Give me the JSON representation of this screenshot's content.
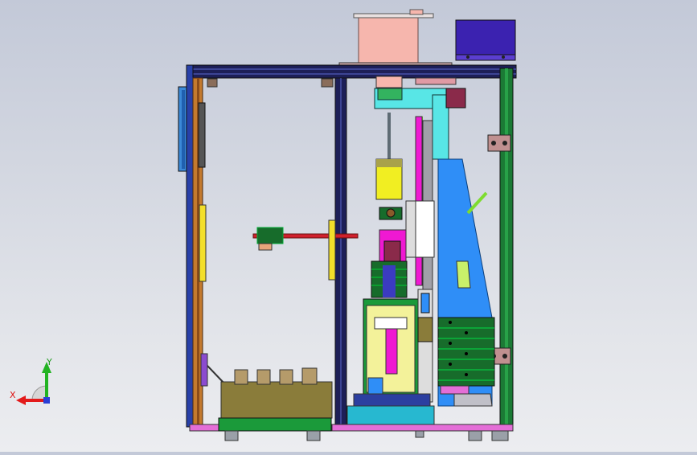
{
  "viewport": {
    "background_top": "#c3c9d8",
    "background_bottom": "#ecedf0"
  },
  "axes": {
    "x_label": "X",
    "y_label": "Y",
    "x_color": "#e31b1b",
    "y_color": "#22b322",
    "z_color": "#2a3fd6"
  },
  "colors": {
    "frame_dark": "#1d1f57",
    "frame_blue": "#2840a8",
    "pink_box": "#f6b6ad",
    "purple_box": "#3b22b0",
    "cyan": "#58e6e6",
    "blue_plate": "#2f8ef7",
    "magenta": "#ef19d2",
    "yellow": "#f1ee22",
    "olive": "#8a7c3a",
    "orange": "#d07a2b",
    "red_rod": "#d0202c",
    "green": "#176c2b",
    "lime": "#7edc2f",
    "base_pink": "#e46ed7"
  }
}
